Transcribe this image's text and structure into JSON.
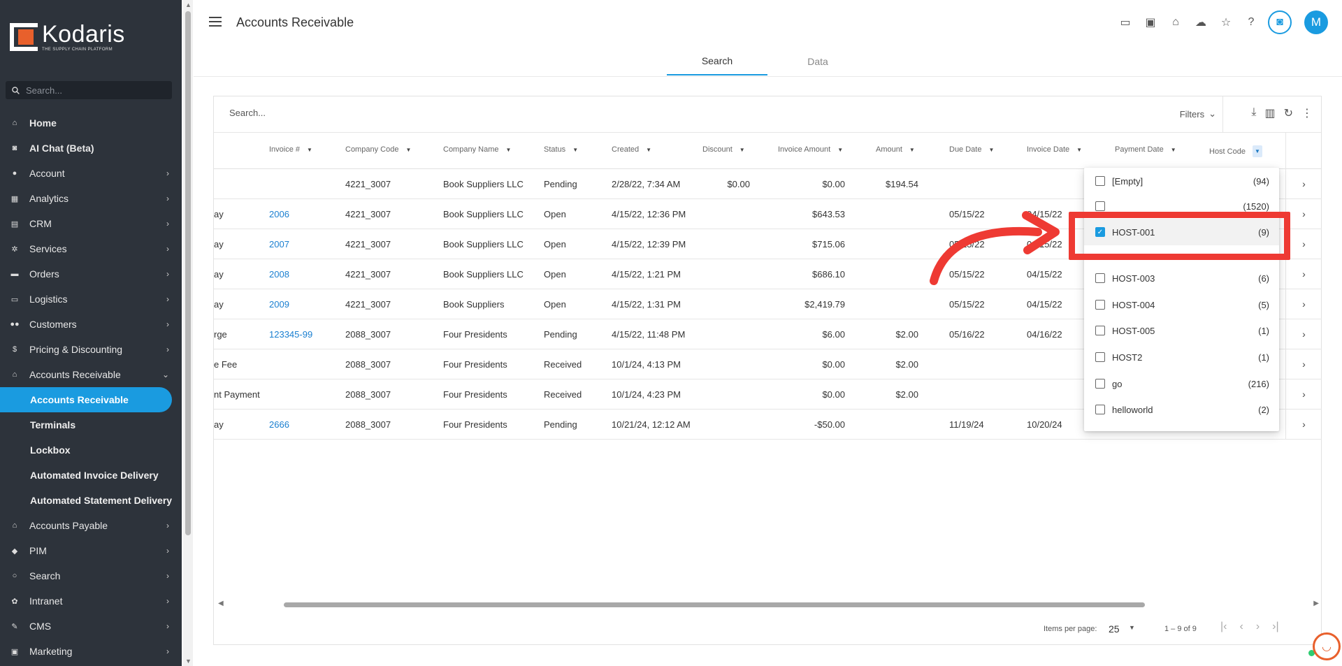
{
  "brand": {
    "name": "Kodaris",
    "tagline": "THE SUPPLY CHAIN PLATFORM"
  },
  "sidebar": {
    "search_placeholder": "Search...",
    "items": [
      {
        "label": "Home",
        "icon": "home-icon",
        "chevron": false
      },
      {
        "label": "AI Chat (Beta)",
        "icon": "robot-icon",
        "chevron": false
      },
      {
        "label": "Account",
        "icon": "person-icon",
        "chevron": true
      },
      {
        "label": "Analytics",
        "icon": "analytics-icon",
        "chevron": true
      },
      {
        "label": "CRM",
        "icon": "crm-icon",
        "chevron": true
      },
      {
        "label": "Services",
        "icon": "services-icon",
        "chevron": true
      },
      {
        "label": "Orders",
        "icon": "truck-icon",
        "chevron": true
      },
      {
        "label": "Logistics",
        "icon": "logistics-icon",
        "chevron": true
      },
      {
        "label": "Customers",
        "icon": "people-icon",
        "chevron": true
      },
      {
        "label": "Pricing & Discounting",
        "icon": "dollar-icon",
        "chevron": true
      },
      {
        "label": "Accounts Receivable",
        "icon": "bank-icon",
        "chevron": true,
        "expanded": true
      }
    ],
    "subitems": [
      "Accounts Receivable",
      "Terminals",
      "Lockbox",
      "Automated Invoice Delivery",
      "Automated Statement Delivery"
    ],
    "items_after": [
      {
        "label": "Accounts Payable",
        "icon": "bank-icon"
      },
      {
        "label": "PIM",
        "icon": "tag-icon"
      },
      {
        "label": "Search",
        "icon": "search-icon"
      },
      {
        "label": "Intranet",
        "icon": "intranet-icon"
      },
      {
        "label": "CMS",
        "icon": "cms-icon"
      },
      {
        "label": "Marketing",
        "icon": "marketing-icon"
      }
    ]
  },
  "header": {
    "title": "Accounts Receivable",
    "avatar_initial": "M",
    "tabs": [
      "Search",
      "Data"
    ]
  },
  "card": {
    "search_placeholder": "Search...",
    "filters_label": "Filters"
  },
  "columns": [
    "Invoice #",
    "Company Code",
    "Company Name",
    "Status",
    "Created",
    "Discount",
    "Invoice Amount",
    "Amount",
    "Due Date",
    "Invoice Date",
    "Payment Date",
    "Host Code"
  ],
  "rows": [
    {
      "type": "",
      "invoice": "",
      "code": "4221_3007",
      "company": "Book Suppliers LLC",
      "status": "Pending",
      "created": "2/28/22, 7:34 AM",
      "discount": "$0.00",
      "invoice_amount": "$0.00",
      "amount": "$194.54",
      "due": "",
      "inv_date": ""
    },
    {
      "type": "ay",
      "invoice": "2006",
      "code": "4221_3007",
      "company": "Book Suppliers LLC",
      "status": "Open",
      "created": "4/15/22, 12:36 PM",
      "discount": "",
      "invoice_amount": "$643.53",
      "amount": "",
      "due": "05/15/22",
      "inv_date": "04/15/22"
    },
    {
      "type": "ay",
      "invoice": "2007",
      "code": "4221_3007",
      "company": "Book Suppliers LLC",
      "status": "Open",
      "created": "4/15/22, 12:39 PM",
      "discount": "",
      "invoice_amount": "$715.06",
      "amount": "",
      "due": "05/15/22",
      "inv_date": "04/15/22"
    },
    {
      "type": "ay",
      "invoice": "2008",
      "code": "4221_3007",
      "company": "Book Suppliers LLC",
      "status": "Open",
      "created": "4/15/22, 1:21 PM",
      "discount": "",
      "invoice_amount": "$686.10",
      "amount": "",
      "due": "05/15/22",
      "inv_date": "04/15/22"
    },
    {
      "type": "ay",
      "invoice": "2009",
      "code": "4221_3007",
      "company": "Book Suppliers",
      "status": "Open",
      "created": "4/15/22, 1:31 PM",
      "discount": "",
      "invoice_amount": "$2,419.79",
      "amount": "",
      "due": "05/15/22",
      "inv_date": "04/15/22"
    },
    {
      "type": "rge",
      "invoice": "123345-99",
      "code": "2088_3007",
      "company": "Four Presidents",
      "status": "Pending",
      "created": "4/15/22, 11:48 PM",
      "discount": "",
      "invoice_amount": "$6.00",
      "amount": "$2.00",
      "due": "05/16/22",
      "inv_date": "04/16/22"
    },
    {
      "type": "e Fee",
      "invoice": "",
      "code": "2088_3007",
      "company": "Four Presidents",
      "status": "Received",
      "created": "10/1/24, 4:13 PM",
      "discount": "",
      "invoice_amount": "$0.00",
      "amount": "$2.00",
      "due": "",
      "inv_date": ""
    },
    {
      "type": "nt Payment",
      "invoice": "",
      "code": "2088_3007",
      "company": "Four Presidents",
      "status": "Received",
      "created": "10/1/24, 4:23 PM",
      "discount": "",
      "invoice_amount": "$0.00",
      "amount": "$2.00",
      "due": "",
      "inv_date": ""
    },
    {
      "type": "ay",
      "invoice": "2666",
      "code": "2088_3007",
      "company": "Four Presidents",
      "status": "Pending",
      "created": "10/21/24, 12:12 AM",
      "discount": "",
      "invoice_amount": "-$50.00",
      "amount": "",
      "due": "11/19/24",
      "inv_date": "10/20/24"
    }
  ],
  "host_code_filter": {
    "options": [
      {
        "label": "[Empty]",
        "count": "(94)",
        "checked": false
      },
      {
        "label": "",
        "count": "(1520)",
        "checked": false
      },
      {
        "label": "HOST-001",
        "count": "(9)",
        "checked": true
      },
      {
        "label": "HOST-003",
        "count": "(6)",
        "checked": false
      },
      {
        "label": "HOST-004",
        "count": "(5)",
        "checked": false
      },
      {
        "label": "HOST-005",
        "count": "(1)",
        "checked": false
      },
      {
        "label": "HOST2",
        "count": "(1)",
        "checked": false
      },
      {
        "label": "go",
        "count": "(216)",
        "checked": false
      },
      {
        "label": "helloworld",
        "count": "(2)",
        "checked": false
      }
    ]
  },
  "paginator": {
    "items_per_page_label": "Items per page:",
    "items_per_page": "25",
    "range": "1 – 9 of 9"
  },
  "colors": {
    "accent": "#1a9be0",
    "annotation": "#ee3a33",
    "sidebar_bg": "#2d333b",
    "brand_orange": "#e8602c"
  }
}
